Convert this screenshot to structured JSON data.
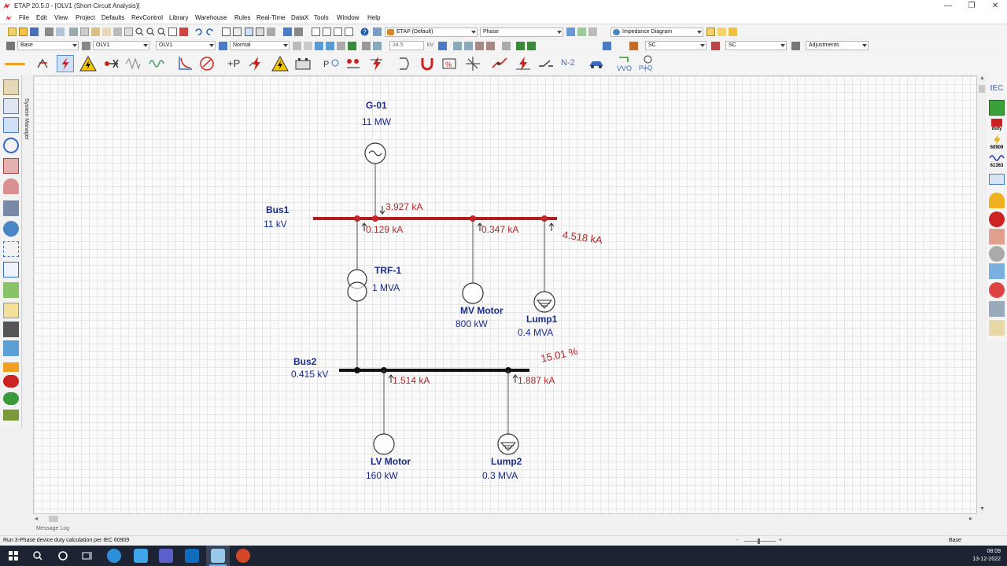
{
  "window": {
    "title": "ETAP 20.5.0 - [OLV1 (Short-Circuit Analysis)]",
    "controls": [
      "—",
      "❐",
      "✕"
    ]
  },
  "menu": [
    "File",
    "Edit",
    "View",
    "Project",
    "Defaults",
    "RevControl",
    "Library",
    "Warehouse",
    "Rules",
    "Real-Time",
    "DataX",
    "Tools",
    "Window",
    "Help"
  ],
  "toolbar1": {
    "library": "ETAP (Default)",
    "phase": "Phase",
    "view": "Impedance Diagram"
  },
  "toolbar2": {
    "revision": "Base",
    "presentation": "OLV1",
    "presentation2": "OLV1",
    "loading": "Normal",
    "voltage_value": "34.5",
    "voltage_unit": "kV",
    "study_case": "SC",
    "output_report": "SC",
    "adjustments": "Adjustments"
  },
  "toolbar3": {
    "n2_label": "N-2",
    "vvo_label": "VVO",
    "pq_label": "P╪Q"
  },
  "side_panel": {
    "system_manager": "System Manager"
  },
  "right_panel": {
    "standard": "IEC",
    "duty_label": "duty",
    "std_60909": "60909",
    "std_61363": "61363"
  },
  "diagram": {
    "generator": {
      "name": "G-01",
      "rating": "11 MW"
    },
    "bus1": {
      "name": "Bus1",
      "voltage": "11 kV",
      "fault_current": "4.518 kA"
    },
    "gen_contribution": "3.927 kA",
    "trf_contribution": "0.129 kA",
    "mv_motor_contribution": "0.347 kA",
    "transformer": {
      "name": "TRF-1",
      "rating": "1 MVA"
    },
    "mv_motor": {
      "name": "MV Motor",
      "rating": "800 kW"
    },
    "lump1": {
      "name": "Lump1",
      "rating": "0.4 MVA"
    },
    "bus2": {
      "name": "Bus2",
      "voltage": "0.415 kV",
      "percent": "15.01 %"
    },
    "lv_motor_contribution": "1.514 kA",
    "lump2_contribution": "1.887 kA",
    "lv_motor": {
      "name": "LV Motor",
      "rating": "160 kW"
    },
    "lump2": {
      "name": "Lump2",
      "rating": "0.3 MVA"
    }
  },
  "message_log": {
    "tab": "Message Log"
  },
  "status": {
    "text": "Run 3-Phase device duty calculation per IEC 60909",
    "config": "Base"
  },
  "clock": {
    "time": "08:09",
    "date": "13-12-2022"
  }
}
